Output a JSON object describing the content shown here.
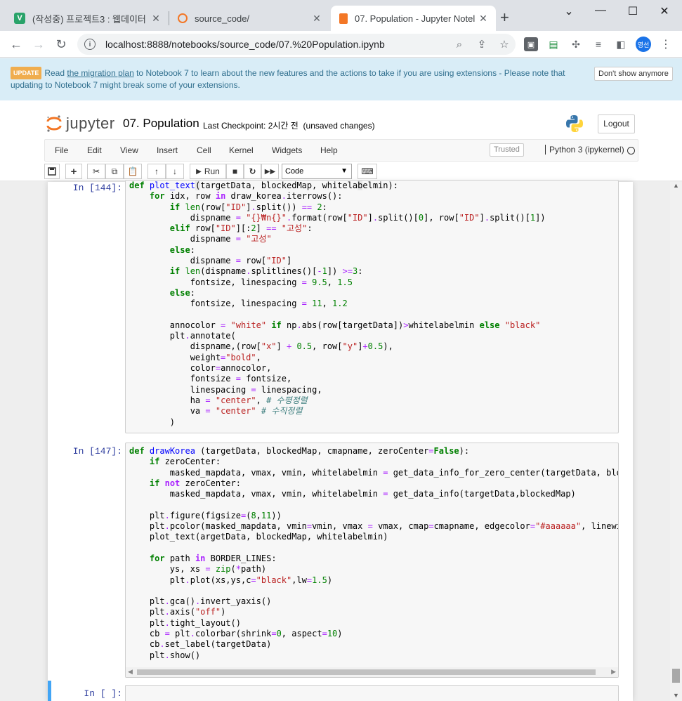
{
  "browser": {
    "tabs": [
      {
        "title": "(작성중) 프로젝트3 : 웹데이터",
        "icon": "v-icon"
      },
      {
        "title": "source_code/",
        "icon": "jupyter-icon"
      },
      {
        "title": "07. Population - Jupyter Notel",
        "icon": "notebook-icon"
      }
    ],
    "new_tab": "+",
    "url": "localhost:8888/notebooks/source_code/07.%20Population.ipynb",
    "avatar_label": "영선"
  },
  "banner": {
    "badge": "UPDATE",
    "text_before": "Read ",
    "link": "the migration plan",
    "text_after": " to Notebook 7 to learn about the new features and the actions to take if you are using extensions - Please note that updating to Notebook 7 might break some of your extensions.",
    "dismiss_label": "Don't show anymore"
  },
  "jupyter": {
    "logo_text": "jupyter",
    "notebook_name": "07. Population",
    "checkpoint": "Last Checkpoint: 2시간 전",
    "unsaved": "(unsaved changes)",
    "logout_label": "Logout",
    "menus": [
      "File",
      "Edit",
      "View",
      "Insert",
      "Cell",
      "Kernel",
      "Widgets",
      "Help"
    ],
    "trusted_label": "Trusted",
    "kernel_name": "Python 3 (ipykernel)",
    "run_label": "Run",
    "cell_type": "Code"
  },
  "cells": [
    {
      "prompt": "In [144]:"
    },
    {
      "prompt": "In [147]:"
    },
    {
      "prompt": "In [ ]:"
    }
  ]
}
